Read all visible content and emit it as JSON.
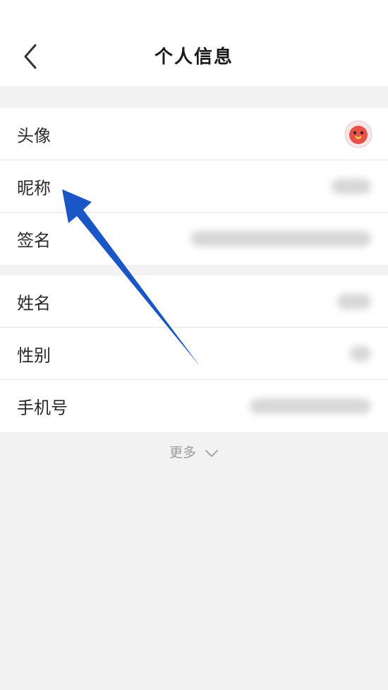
{
  "header": {
    "title": "个人信息",
    "back_icon": "chevron-left-icon"
  },
  "profile": {
    "group1": [
      {
        "label": "头像",
        "value_type": "avatar"
      },
      {
        "label": "昵称",
        "value_type": "blurred"
      },
      {
        "label": "签名",
        "value_type": "blurred"
      }
    ],
    "group2": [
      {
        "label": "姓名",
        "value_type": "blurred"
      },
      {
        "label": "性别",
        "value_type": "blurred"
      },
      {
        "label": "手机号",
        "value_type": "blurred"
      }
    ]
  },
  "more": {
    "label": "更多",
    "icon": "chevron-down-icon"
  },
  "colors": {
    "background": "#f2f2f2",
    "card": "#ffffff",
    "annotation_arrow": "#1b56c6",
    "avatar_bg": "#e8514a"
  }
}
